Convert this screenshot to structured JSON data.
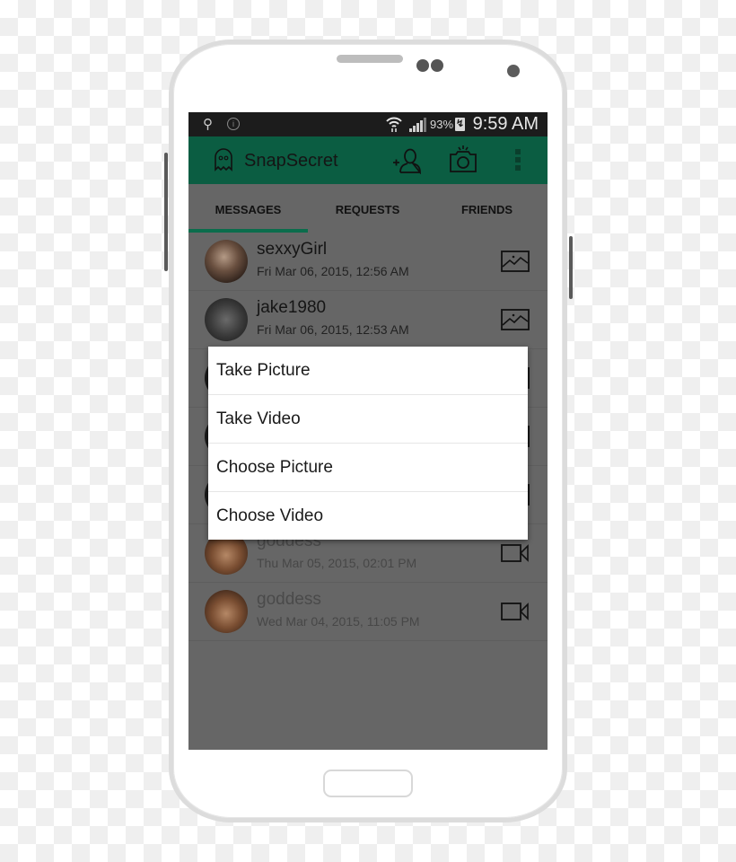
{
  "status_bar": {
    "usb_icon": "usb-icon",
    "info_icon": "info-icon",
    "wifi_icon": "wifi-icon",
    "signal_icon": "signal-icon",
    "battery_percent": "93%",
    "battery_icon": "battery-charging-icon",
    "time": "9:59 AM"
  },
  "app_bar": {
    "logo_icon": "ghost-icon",
    "title": "SnapSecret",
    "actions": [
      "add-friend-icon",
      "camera-icon",
      "overflow-menu-icon"
    ]
  },
  "tabs": [
    {
      "label": "MESSAGES",
      "selected": true
    },
    {
      "label": "REQUESTS",
      "selected": false
    },
    {
      "label": "FRIENDS",
      "selected": false
    }
  ],
  "accent_color": "#0b5d42",
  "messages": [
    {
      "name": "sexxyGirl",
      "date": "Fri Mar 06, 2015, 12:56 AM",
      "media": "image-icon"
    },
    {
      "name": "jake1980",
      "date": "Fri Mar 06, 2015, 12:53 AM",
      "media": "image-icon"
    },
    {
      "name": "",
      "date": "",
      "media": "image-icon"
    },
    {
      "name": "",
      "date": "",
      "media": "image-icon"
    },
    {
      "name": "",
      "date": "",
      "media": "image-icon"
    },
    {
      "name": "goddess",
      "date": "Thu Mar 05, 2015, 02:01 PM",
      "media": "video-icon"
    },
    {
      "name": "goddess",
      "date": "Wed Mar 04, 2015, 11:05 PM",
      "media": "video-icon"
    }
  ],
  "popup_menu": {
    "items": [
      "Take Picture",
      "Take Video",
      "Choose Picture",
      "Choose Video"
    ]
  }
}
